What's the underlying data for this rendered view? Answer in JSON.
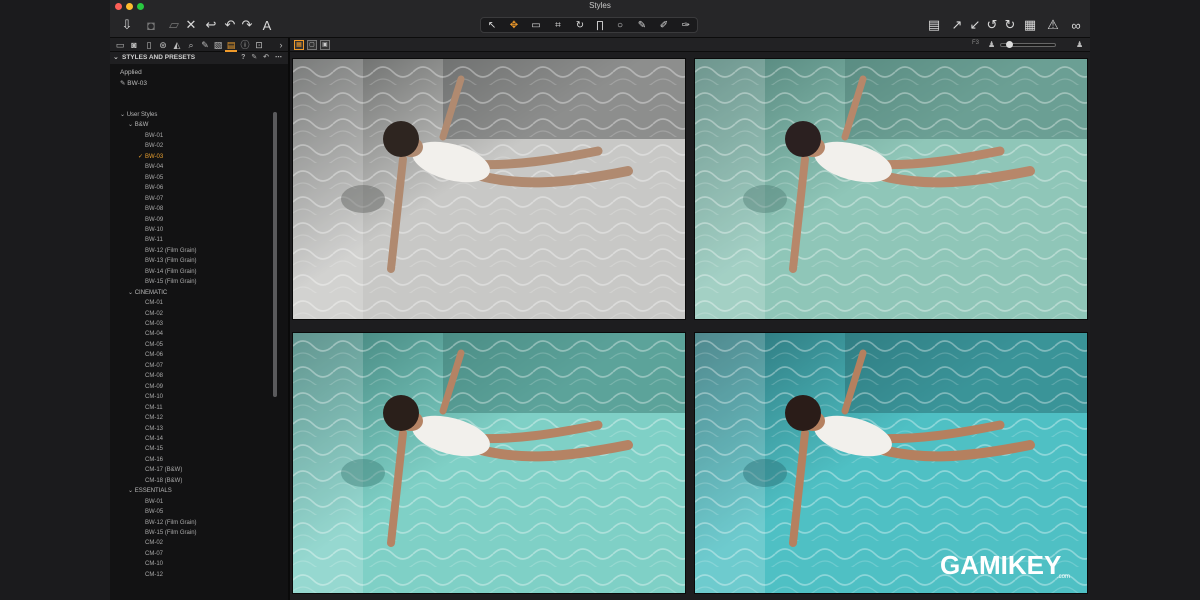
{
  "window": {
    "title": "Styles"
  },
  "toolbar": {
    "left_icons": [
      "download-icon",
      "camera-icon",
      "folder-icon",
      "close-x-icon",
      "rotate-back-icon",
      "undo-icon",
      "redo-icon",
      "text-tool-icon"
    ],
    "center_tools": [
      "select-icon",
      "pan-icon",
      "viewer-icon",
      "crop-icon",
      "rotate-icon",
      "keystone-icon",
      "spot-icon",
      "brush-icon",
      "eraser-icon",
      "gradient-icon"
    ],
    "center_glyphs": [
      "↖",
      "✥",
      "▭",
      "⌗",
      "↻",
      "∏",
      "○",
      "✎",
      "✐",
      "✑"
    ],
    "right_icons": [
      "layers-icon",
      "arrow-icon",
      "check-arrow-icon",
      "rotate-left-icon",
      "rotate-right-icon",
      "grid-icon",
      "warning-icon",
      "glasses-icon"
    ]
  },
  "panel": {
    "header": "STYLES AND PRESETS",
    "applied_label": "Applied",
    "applied_value": "BW-03",
    "tree": [
      {
        "label": "User Styles",
        "level": 0,
        "group": true
      },
      {
        "label": "B&W",
        "level": 1,
        "group": true
      },
      {
        "label": "BW-01",
        "level": 2
      },
      {
        "label": "BW-02",
        "level": 2
      },
      {
        "label": "BW-03",
        "level": 2,
        "checked": true
      },
      {
        "label": "BW-04",
        "level": 2
      },
      {
        "label": "BW-05",
        "level": 2
      },
      {
        "label": "BW-06",
        "level": 2
      },
      {
        "label": "BW-07",
        "level": 2
      },
      {
        "label": "BW-08",
        "level": 2
      },
      {
        "label": "BW-09",
        "level": 2
      },
      {
        "label": "BW-10",
        "level": 2
      },
      {
        "label": "BW-11",
        "level": 2
      },
      {
        "label": "BW-12 (Film Grain)",
        "level": 2
      },
      {
        "label": "BW-13 (Film Grain)",
        "level": 2
      },
      {
        "label": "BW-14 (Film Grain)",
        "level": 2
      },
      {
        "label": "BW-15 (Film Grain)",
        "level": 2
      },
      {
        "label": "CINEMATIC",
        "level": 1,
        "group": true
      },
      {
        "label": "CM-01",
        "level": 2
      },
      {
        "label": "CM-02",
        "level": 2
      },
      {
        "label": "CM-03",
        "level": 2
      },
      {
        "label": "CM-04",
        "level": 2
      },
      {
        "label": "CM-05",
        "level": 2
      },
      {
        "label": "CM-06",
        "level": 2
      },
      {
        "label": "CM-07",
        "level": 2
      },
      {
        "label": "CM-08",
        "level": 2
      },
      {
        "label": "CM-09",
        "level": 2
      },
      {
        "label": "CM-10",
        "level": 2
      },
      {
        "label": "CM-11",
        "level": 2
      },
      {
        "label": "CM-12",
        "level": 2
      },
      {
        "label": "CM-13",
        "level": 2
      },
      {
        "label": "CM-14",
        "level": 2
      },
      {
        "label": "CM-15",
        "level": 2
      },
      {
        "label": "CM-16",
        "level": 2
      },
      {
        "label": "CM-17 (B&W)",
        "level": 2
      },
      {
        "label": "CM-18 (B&W)",
        "level": 2
      },
      {
        "label": "ESSENTIALS",
        "level": 1,
        "group": true
      },
      {
        "label": "BW-01",
        "level": 2
      },
      {
        "label": "BW-05",
        "level": 2
      },
      {
        "label": "BW-12 (Film Grain)",
        "level": 2
      },
      {
        "label": "BW-15 (Film Grain)",
        "level": 2
      },
      {
        "label": "CM-02",
        "level": 2
      },
      {
        "label": "CM-07",
        "level": 2
      },
      {
        "label": "CM-10",
        "level": 2
      },
      {
        "label": "CM-12",
        "level": 2
      }
    ]
  },
  "viewer": {
    "zoom_label": "F3",
    "photos": [
      {
        "name": "preview-bw-03",
        "water": "#c8c8c6",
        "water_dark": "#5d5f5e",
        "skin": "#b08a70",
        "hair": "#2e2520"
      },
      {
        "name": "preview-style-2",
        "water": "#8fc6b8",
        "water_dark": "#4f7f76",
        "skin": "#b7876a",
        "hair": "#2b2020"
      },
      {
        "name": "preview-style-3",
        "water": "#7fd0c6",
        "water_dark": "#3f7e77",
        "skin": "#b58364",
        "hair": "#2a1f1a"
      },
      {
        "name": "preview-style-4",
        "water": "#4fc0c4",
        "water_dark": "#2a6f75",
        "skin": "#b5805f",
        "hair": "#2a1c18"
      }
    ]
  },
  "watermark": {
    "text": "GAMIKEY",
    "suffix": ".com"
  },
  "colors": {
    "accent": "#f09a2a",
    "bg": "#111112",
    "panel": "#121213"
  }
}
